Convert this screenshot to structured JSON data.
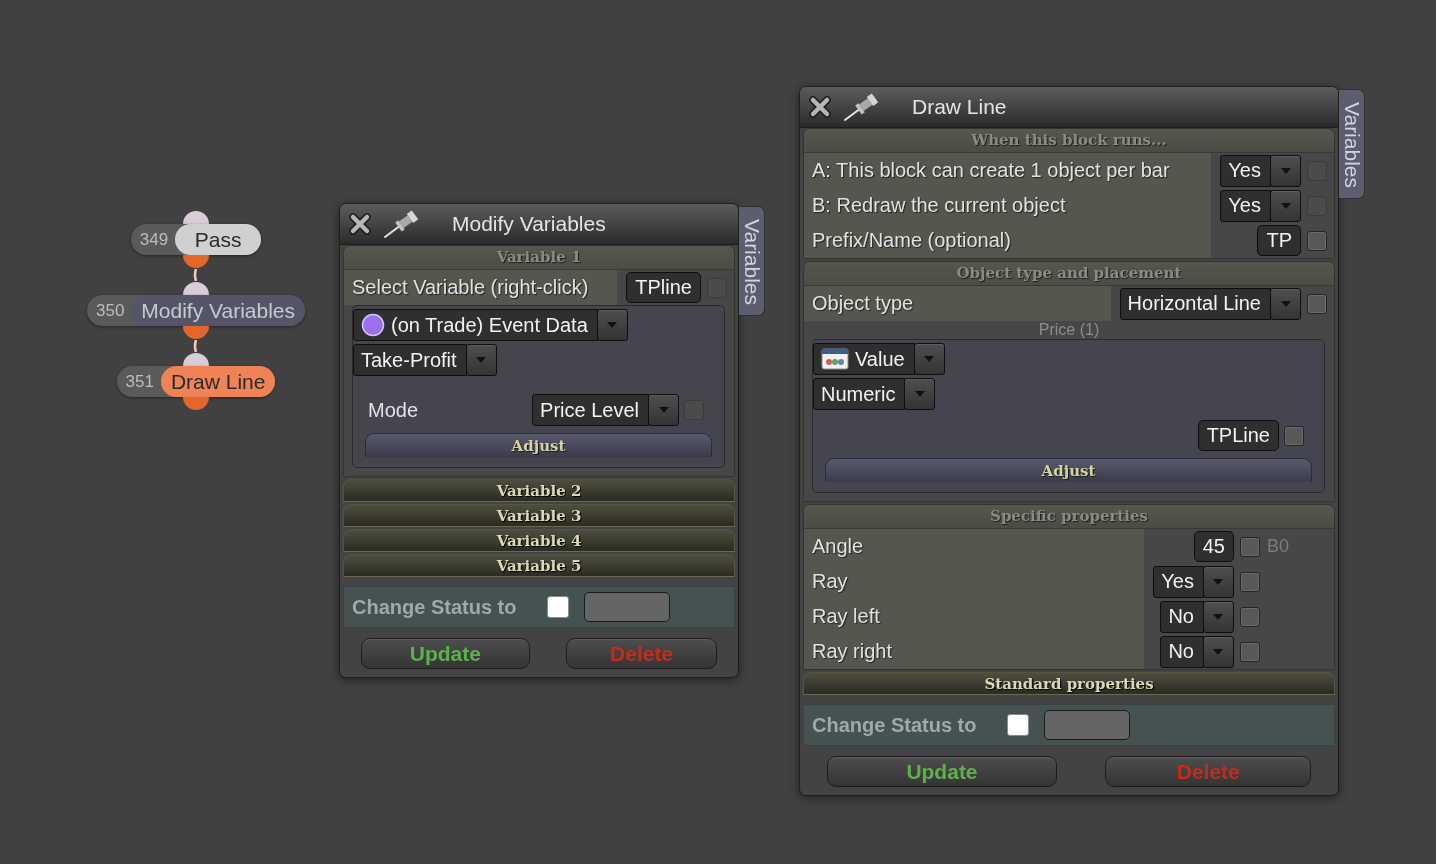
{
  "nodes": [
    {
      "number": "349",
      "label": "Pass",
      "color": "#d0d0d0"
    },
    {
      "number": "350",
      "label": "Modify Variables",
      "color": "#555568"
    },
    {
      "number": "351",
      "label": "Draw Line",
      "color": "#ef8355"
    }
  ],
  "windows": [
    {
      "title": "Modify Variables",
      "side_tab": "Variables",
      "sections": [
        {
          "title": "Variable 1",
          "expanded": true,
          "items": [
            {
              "kind": "field",
              "label": "Select Variable (right-click)",
              "value": "TPline",
              "checkbox": {
                "checked": false,
                "disabled": true
              }
            },
            {
              "kind": "group",
              "items": [
                {
                  "kind": "event-source",
                  "value": "(on Trade) Event Data"
                },
                {
                  "kind": "dropdown",
                  "value": "Take-Profit"
                },
                {
                  "kind": "dropdown",
                  "label": "Mode",
                  "value": "Price Level",
                  "checkbox": {
                    "checked": false,
                    "disabled": true
                  }
                },
                {
                  "kind": "button",
                  "label": "Adjust"
                }
              ]
            }
          ]
        },
        {
          "title": "Variable 2",
          "expanded": false
        },
        {
          "title": "Variable 3",
          "expanded": false
        },
        {
          "title": "Variable 4",
          "expanded": false
        },
        {
          "title": "Variable 5",
          "expanded": false
        }
      ],
      "status": {
        "label": "Change Status to",
        "checked": false
      },
      "buttons": [
        {
          "kind": "update",
          "label": "Update"
        },
        {
          "kind": "delete",
          "label": "Delete"
        }
      ]
    },
    {
      "title": "Draw Line",
      "side_tab": "Variables",
      "sections": [
        {
          "title": "When this block runs...",
          "expanded": true,
          "items": [
            {
              "kind": "dropdown",
              "label": "A: This block can create 1 object per bar",
              "value": "Yes",
              "checkbox": {
                "checked": false,
                "disabled": true
              }
            },
            {
              "kind": "dropdown",
              "label": "B: Redraw the current object",
              "value": "Yes",
              "checkbox": {
                "checked": false,
                "disabled": true
              }
            },
            {
              "kind": "field",
              "label": "Prefix/Name (optional)",
              "value": "TP",
              "checkbox": {
                "checked": false,
                "disabled": false
              }
            }
          ]
        },
        {
          "title": "Object type and placement",
          "expanded": true,
          "items": [
            {
              "kind": "dropdown",
              "label": "Object type",
              "value": "Horizontal Line",
              "checkbox": {
                "checked": false,
                "disabled": false
              }
            },
            {
              "kind": "caption",
              "text": "Price (1)"
            },
            {
              "kind": "group",
              "items": [
                {
                  "kind": "value-source",
                  "value": "Value"
                },
                {
                  "kind": "dropdown",
                  "value": "Numeric"
                },
                {
                  "kind": "field",
                  "value": "TPLine",
                  "checkbox": {
                    "checked": false,
                    "disabled": false
                  }
                },
                {
                  "kind": "button",
                  "label": "Adjust"
                }
              ]
            }
          ]
        },
        {
          "title": "Specific properties",
          "expanded": true,
          "items": [
            {
              "kind": "field",
              "label": "Angle",
              "value": "45",
              "checkbox": {
                "checked": false,
                "disabled": false
              },
              "suffix": "B0"
            },
            {
              "kind": "dropdown",
              "label": "Ray",
              "value": "Yes",
              "checkbox": {
                "checked": false,
                "disabled": false
              }
            },
            {
              "kind": "dropdown",
              "label": "Ray left",
              "value": "No",
              "checkbox": {
                "checked": false,
                "disabled": false
              }
            },
            {
              "kind": "dropdown",
              "label": "Ray right",
              "value": "No",
              "checkbox": {
                "checked": false,
                "disabled": false
              }
            }
          ]
        },
        {
          "title": "Standard properties",
          "expanded": false
        }
      ],
      "status": {
        "label": "Change Status to",
        "checked": false
      },
      "buttons": [
        {
          "kind": "update",
          "label": "Update"
        },
        {
          "kind": "delete",
          "label": "Delete"
        }
      ]
    }
  ]
}
